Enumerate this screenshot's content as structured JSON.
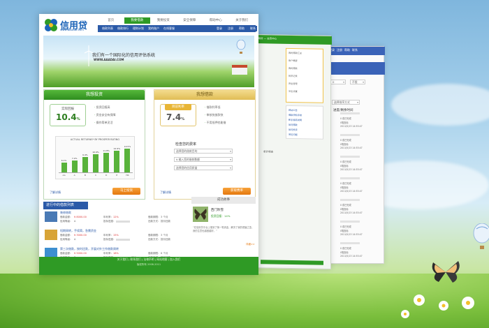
{
  "brand": {
    "name": "信用贷",
    "url": "www.aaadai.com"
  },
  "nav": {
    "items": [
      "首页",
      "我要借款",
      "我要投资",
      "安全保障",
      "帮助中心",
      "关于我们"
    ],
    "active": 1
  },
  "top_links": [
    "登录",
    "注册",
    "帮助",
    "联系"
  ],
  "subnav": [
    "借款列表",
    "借款排行",
    "理财计划",
    "我的账户",
    "在线客服"
  ],
  "banner": {
    "text": "我们有一个国际化的信用评估系统",
    "url": "WWW.AAADAI.COM"
  },
  "invest": {
    "title": "我想投资",
    "rate_label": "实际回报",
    "rate_value": "10.4",
    "rate_unit": "%",
    "bullets": [
      "投资回报高",
      "资金安全有保障",
      "操作简单灵活"
    ],
    "chart_title": "ACTUAL RETURNS* BY PROSPER RATING",
    "more": "了解详情",
    "button": "马上投资"
  },
  "borrow": {
    "title": "我想借款",
    "rate_label": "目前利率",
    "rate_value": "7.4",
    "rate_unit": "%",
    "bullets": [
      "借款利率低",
      "审核快放款快",
      "不用抵押也能借"
    ],
    "form_title": "检查您的费率",
    "fields": [
      "选择您的借款目的",
      "输入您的借款数额",
      "选择您的信用质量"
    ],
    "more": "了解详情",
    "button": "获取费率"
  },
  "chart_data": {
    "type": "bar",
    "title": "ACTUAL RETURNS* BY PROSPER RATING",
    "categories": [
      "AA",
      "A",
      "B",
      "C",
      "D",
      "E",
      "HR"
    ],
    "values": [
      6.1,
      7.2,
      9.4,
      10.9,
      11.8,
      12.9,
      14.5
    ],
    "value_labels": [
      "6.1%",
      "7.2%",
      "9.4%",
      "10.9%",
      "11.8%",
      "12.9%",
      "14.5%"
    ],
    "ylim": [
      0,
      16
    ]
  },
  "listing": {
    "title": "进行中的借款列表",
    "rows": [
      {
        "title": "装修借款",
        "amount_label": "借款金额：",
        "amount": "¥ 8000.00",
        "rate_label": "年利率：",
        "rate": "12%",
        "term_label": "借款期限：",
        "term": "3 个月",
        "progress_label": "投标进度：",
        "progress": 0.0,
        "credit_label": "信用等级：",
        "credit": "A",
        "repay_label": "还款方式：",
        "repay": "按月还款"
      },
      {
        "title": "短期周转，手续简，急需资金",
        "amount_label": "借款金额：",
        "amount": "¥ 3000.00",
        "rate_label": "年利率：",
        "rate": "15%",
        "term_label": "借款期限：",
        "term": "3 个月",
        "progress_label": "投标进度：",
        "progress": 0.0,
        "credit_label": "信用等级：",
        "credit": "A",
        "repay_label": "还款方式：",
        "repay": "按月还款"
      },
      {
        "title": "第三次借款，按时还款，开展对外工作借款周转",
        "amount_label": "借款金额：",
        "amount": "¥ 5000.00",
        "rate_label": "年利率：",
        "rate": "18%",
        "term_label": "借款期限：",
        "term": "6 个月",
        "progress_label": "投标进度：",
        "progress": 0.82,
        "progress_text": "82%",
        "credit_label": "信用等级：",
        "credit": "B",
        "repay_label": "还款方式：",
        "repay": "按月还款"
      }
    ]
  },
  "story": {
    "title": "成功故事",
    "name": "西门吹雪",
    "sub": "投资回报：14%",
    "quote": "“在信用贷平台上借到了第一笔资金，解决了我的燃眉之急，我的生意也越做越好。”",
    "more": "详细>>"
  },
  "footer": {
    "links": "关于我们 | 联系我们 | 法律声明 | 网站地图 | 加入我们",
    "copy": "版权所有 2008-2011"
  },
  "win2": {
    "header": "信用贷 — 会员中心",
    "sections": [
      "我的借款汇总",
      "账户概要",
      "我的借款",
      "投资记录",
      "资金管理",
      "安全设置"
    ],
    "links": [
      "网站公告",
      "借款须知手续",
      "新手指南说明",
      "如何借款",
      "如何投资",
      "常见问题"
    ],
    "status": "总计状态"
  },
  "win3": {
    "top_links": [
      "登录",
      "注册",
      "帮助",
      "联系"
    ],
    "select_a": "0",
    "select_b": "不限",
    "sort_label": "选择排序方式",
    "column": "进度/剩余时间",
    "items": [
      {
        "status": "0 成已完成",
        "sub": "0笔投标",
        "date": "2011/5/13 14:53:47"
      },
      {
        "status": "0 成已完成",
        "sub": "0笔投标",
        "date": "2011/5/13 14:53:47"
      },
      {
        "status": "0 成已完成",
        "sub": "0笔投标",
        "date": "2011/5/13 14:53:47"
      },
      {
        "status": "0 成已完成",
        "sub": "0笔投标",
        "date": "2011/5/13 14:53:47"
      },
      {
        "status": "0 成已完成",
        "sub": "0笔投标",
        "date": "2011/5/13 14:53:47"
      },
      {
        "status": "0 成已完成",
        "sub": "0笔投标",
        "date": "2011/5/13 14:53:47"
      },
      {
        "status": "0 成已完成",
        "sub": "0笔投标",
        "date": "2011/5/13 14:53:47"
      }
    ]
  }
}
